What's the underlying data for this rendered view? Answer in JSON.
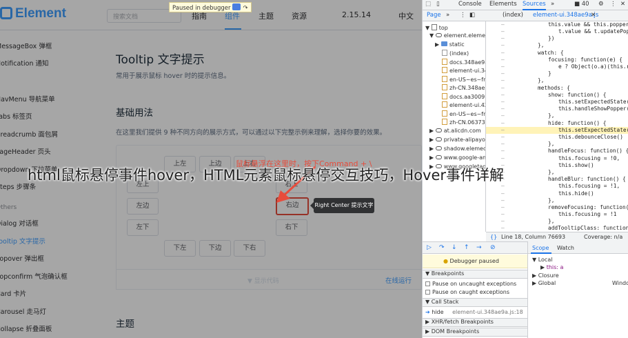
{
  "header": {
    "logo": "Element",
    "search_placeholder": "搜索文档",
    "nav": [
      "指南",
      "组件",
      "主题",
      "资源"
    ],
    "version": "2.15.14",
    "lang": "中文"
  },
  "debugger_bar": "Paused in debugger",
  "sidebar": {
    "items": [
      {
        "label": "MessageBox 弹框"
      },
      {
        "label": "Notification 通知"
      },
      {
        "label": "NavMenu 导航菜单"
      },
      {
        "label": "Tabs 标签页"
      },
      {
        "label": "Breadcrumb 面包屑"
      },
      {
        "label": "PageHeader 页头"
      },
      {
        "label": "Dropdown 下拉菜单"
      },
      {
        "label": "Steps 步骤条"
      }
    ],
    "group": "Others",
    "items2": [
      {
        "label": "Dialog 对话框"
      },
      {
        "label": "Tooltip 文字提示"
      },
      {
        "label": "Popover 弹出框"
      },
      {
        "label": "Popconfirm 气泡确认框"
      },
      {
        "label": "Card 卡片"
      },
      {
        "label": "Carousel 走马灯"
      },
      {
        "label": "Collapse 折叠面板"
      }
    ]
  },
  "main": {
    "title": "Tooltip 文字提示",
    "desc": "常用于展示鼠标 hover 时的提示信息。",
    "section1": "基础用法",
    "section1_desc": "在这里我们提供 9 种不同方向的展示方式，可以通过以下完整示例来理解，选择你要的效果。",
    "buttons": {
      "top_left": "上左",
      "top": "上边",
      "top_right": "上右",
      "left_top": "左上",
      "left": "左边",
      "left_bottom": "左下",
      "right_top": "右上",
      "right": "右边",
      "right_bottom": "右下",
      "bottom_left": "下左",
      "bottom": "下边",
      "bottom_right": "下右"
    },
    "tooltip": "Right Center 提示文字",
    "annotation": "鼠标悬浮在这里时，按下Command + \\",
    "show_code": "显示代码",
    "run_online": "在线运行",
    "section2": "主题"
  },
  "watermark": "html鼠标悬停事件hover，HTML元素鼠标悬停交互技巧，Hover事件详解",
  "devtools": {
    "tabs": [
      "Console",
      "Elements",
      "Sources"
    ],
    "badge": "40",
    "panel_tab": "Page",
    "file_tabs": [
      "(index)",
      "element-ui.348ae9a.js"
    ],
    "tree": [
      "top",
      "element.eleme.io",
      "static",
      "(index)",
      "docs.348ae9a",
      "element-ui.34",
      "en-US~es~fr",
      "zh-CN.348ae",
      "docs.aa3009b",
      "element-ui.42",
      "en-US~es~fr",
      "zh-CN.06373",
      "at.alicdn.com",
      "private-alipayob",
      "shadow.elemeco",
      "www.google-ana",
      "www.googletag"
    ],
    "code": [
      "this.value && this.popperV",
      "t.value && t.updatePop",
      "})",
      "},",
      "watch: {",
      "focusing: function(e) {",
      "e ? Object(o.a)(this.r",
      "}",
      "},",
      "methods: {",
      "show: function() {",
      "this.setExpectedState(",
      "this.handleShowPopper(",
      "},",
      "hide: function() {",
      "this.setExpectedState(",
      "this.debounceClose()",
      "},",
      "handleFocus: function() {",
      "this.focusing = !0,",
      "this.show()",
      "},",
      "handleBlur: function() {",
      "this.focusing = !1,",
      "this.hide()",
      "},",
      "removeFocusing: function(",
      "this.focusing = !1",
      "},",
      "addTooltipClass: function("
    ],
    "status_line": "Line 18, Column 76693",
    "coverage": "Coverage: n/a",
    "paused_msg": "Debugger paused",
    "breakpoints_header": "Breakpoints",
    "pause_uncaught": "Pause on uncaught exceptions",
    "pause_caught": "Pause on caught exceptions",
    "callstack_header": "Call Stack",
    "callstack_fn": "hide",
    "callstack_loc": "element-ui.348ae9a.js:18",
    "xhr_header": "XHR/fetch Breakpoints",
    "dom_header": "DOM Breakpoints",
    "scope_tab": "Scope",
    "watch_tab": "Watch",
    "scope_local": "Local",
    "scope_this": "this: a",
    "scope_closure": "Closure",
    "scope_global": "Global",
    "scope_window": "Window"
  }
}
